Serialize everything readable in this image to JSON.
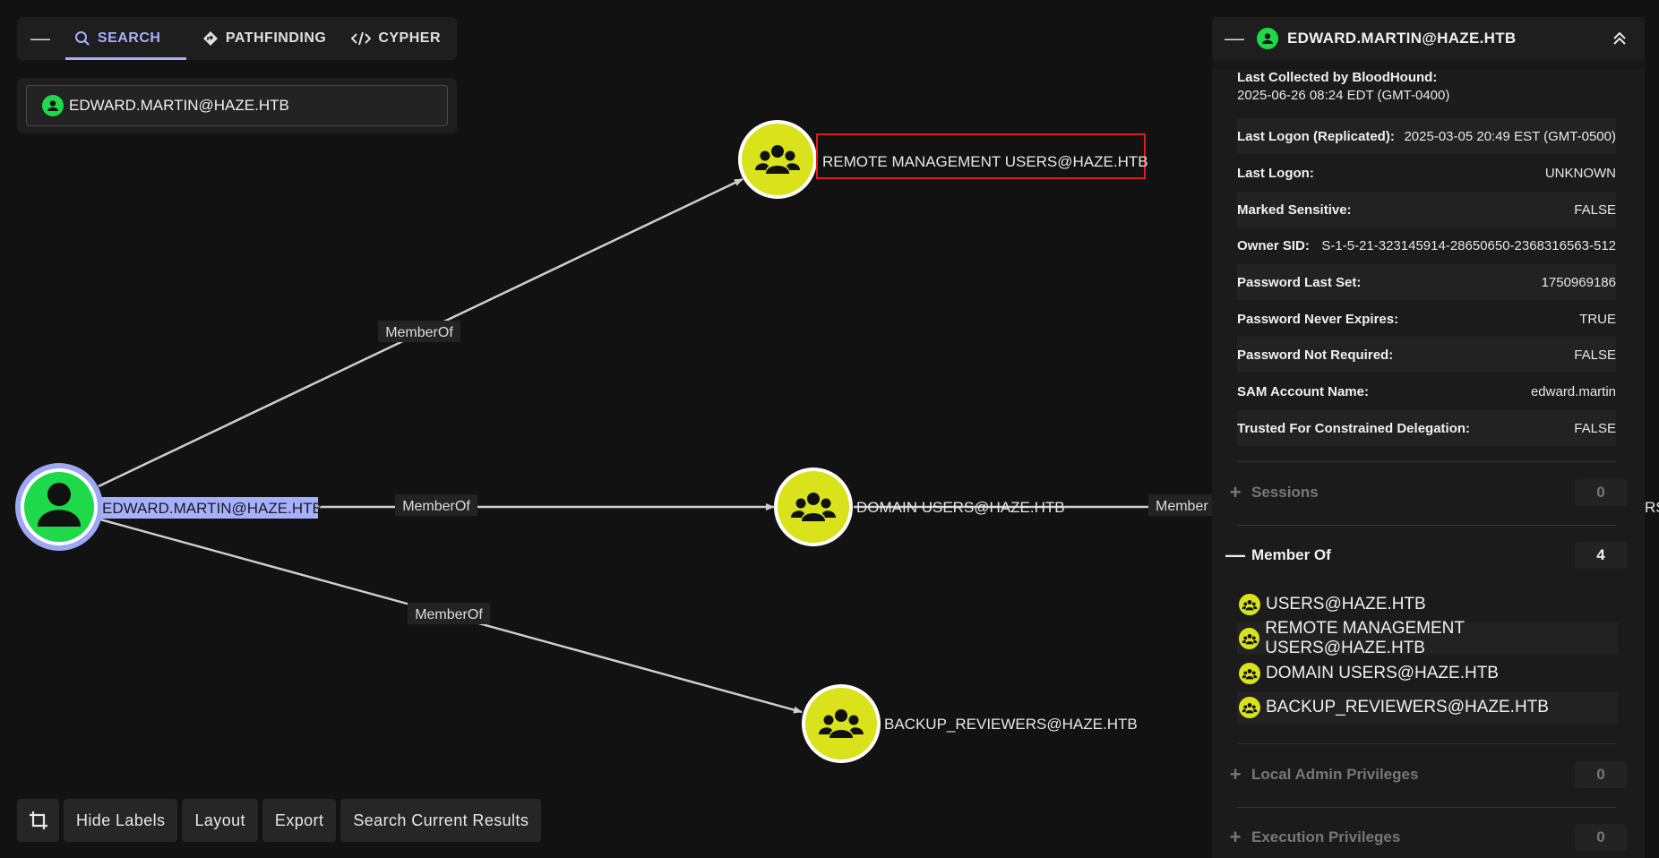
{
  "topbar": {
    "tabs": [
      {
        "label": "SEARCH",
        "icon": "search-icon"
      },
      {
        "label": "PATHFINDING",
        "icon": "diamond-route-icon"
      },
      {
        "label": "CYPHER",
        "icon": "code-icon"
      }
    ],
    "collapse_icon": "minus-icon"
  },
  "search": {
    "value": "EDWARD.MARTIN@HAZE.HTB"
  },
  "graph": {
    "nodes": [
      {
        "label": "EDWARD.MARTIN@HAZE.HTB",
        "kind": "user"
      },
      {
        "label": "REMOTE MANAGEMENT USERS@HAZE.HTB",
        "kind": "group"
      },
      {
        "label": "DOMAIN USERS@HAZE.HTB",
        "kind": "group"
      },
      {
        "label": "BACKUP_REVIEWERS@HAZE.HTB",
        "kind": "group"
      }
    ],
    "edges": [
      {
        "label": "MemberOf"
      },
      {
        "label": "MemberOf"
      },
      {
        "label": "MemberOf"
      },
      {
        "label": "Member"
      }
    ],
    "offscreen_label": "RS"
  },
  "bottombar": {
    "buttons": [
      "Hide Labels",
      "Layout",
      "Export",
      "Search Current Results"
    ],
    "crop_icon": "crop-icon"
  },
  "details": {
    "title": "EDWARD.MARTIN@HAZE.HTB",
    "last_collected_key": "Last Collected by BloodHound:",
    "last_collected_val": "2025-06-26 08:24 EDT (GMT-0400)",
    "properties": [
      {
        "key": "Last Logon (Replicated):",
        "value": "2025-03-05 20:49 EST (GMT-0500)"
      },
      {
        "key": "Last Logon:",
        "value": "UNKNOWN"
      },
      {
        "key": "Marked Sensitive:",
        "value": "FALSE"
      },
      {
        "key": "Owner SID:",
        "value": "S-1-5-21-323145914-28650650-2368316563-512"
      },
      {
        "key": "Password Last Set:",
        "value": "1750969186"
      },
      {
        "key": "Password Never Expires:",
        "value": "TRUE"
      },
      {
        "key": "Password Not Required:",
        "value": "FALSE"
      },
      {
        "key": "SAM Account Name:",
        "value": "edward.martin"
      },
      {
        "key": "Trusted For Constrained Delegation:",
        "value": "FALSE"
      }
    ],
    "sections": {
      "sessions": {
        "label": "Sessions",
        "count": "0"
      },
      "member_of": {
        "label": "Member Of",
        "count": "4"
      },
      "local_admin": {
        "label": "Local Admin Privileges",
        "count": "0"
      },
      "execution": {
        "label": "Execution Privileges",
        "count": "0"
      }
    },
    "member_of": [
      "USERS@HAZE.HTB",
      "REMOTE MANAGEMENT USERS@HAZE.HTB",
      "DOMAIN USERS@HAZE.HTB",
      "BACKUP_REVIEWERS@HAZE.HTB"
    ]
  },
  "colors": {
    "user_node": "#1ed94a",
    "group_node": "#d9e21b",
    "accent": "#a5b1ff",
    "highlight_box": "#e01b1b"
  }
}
